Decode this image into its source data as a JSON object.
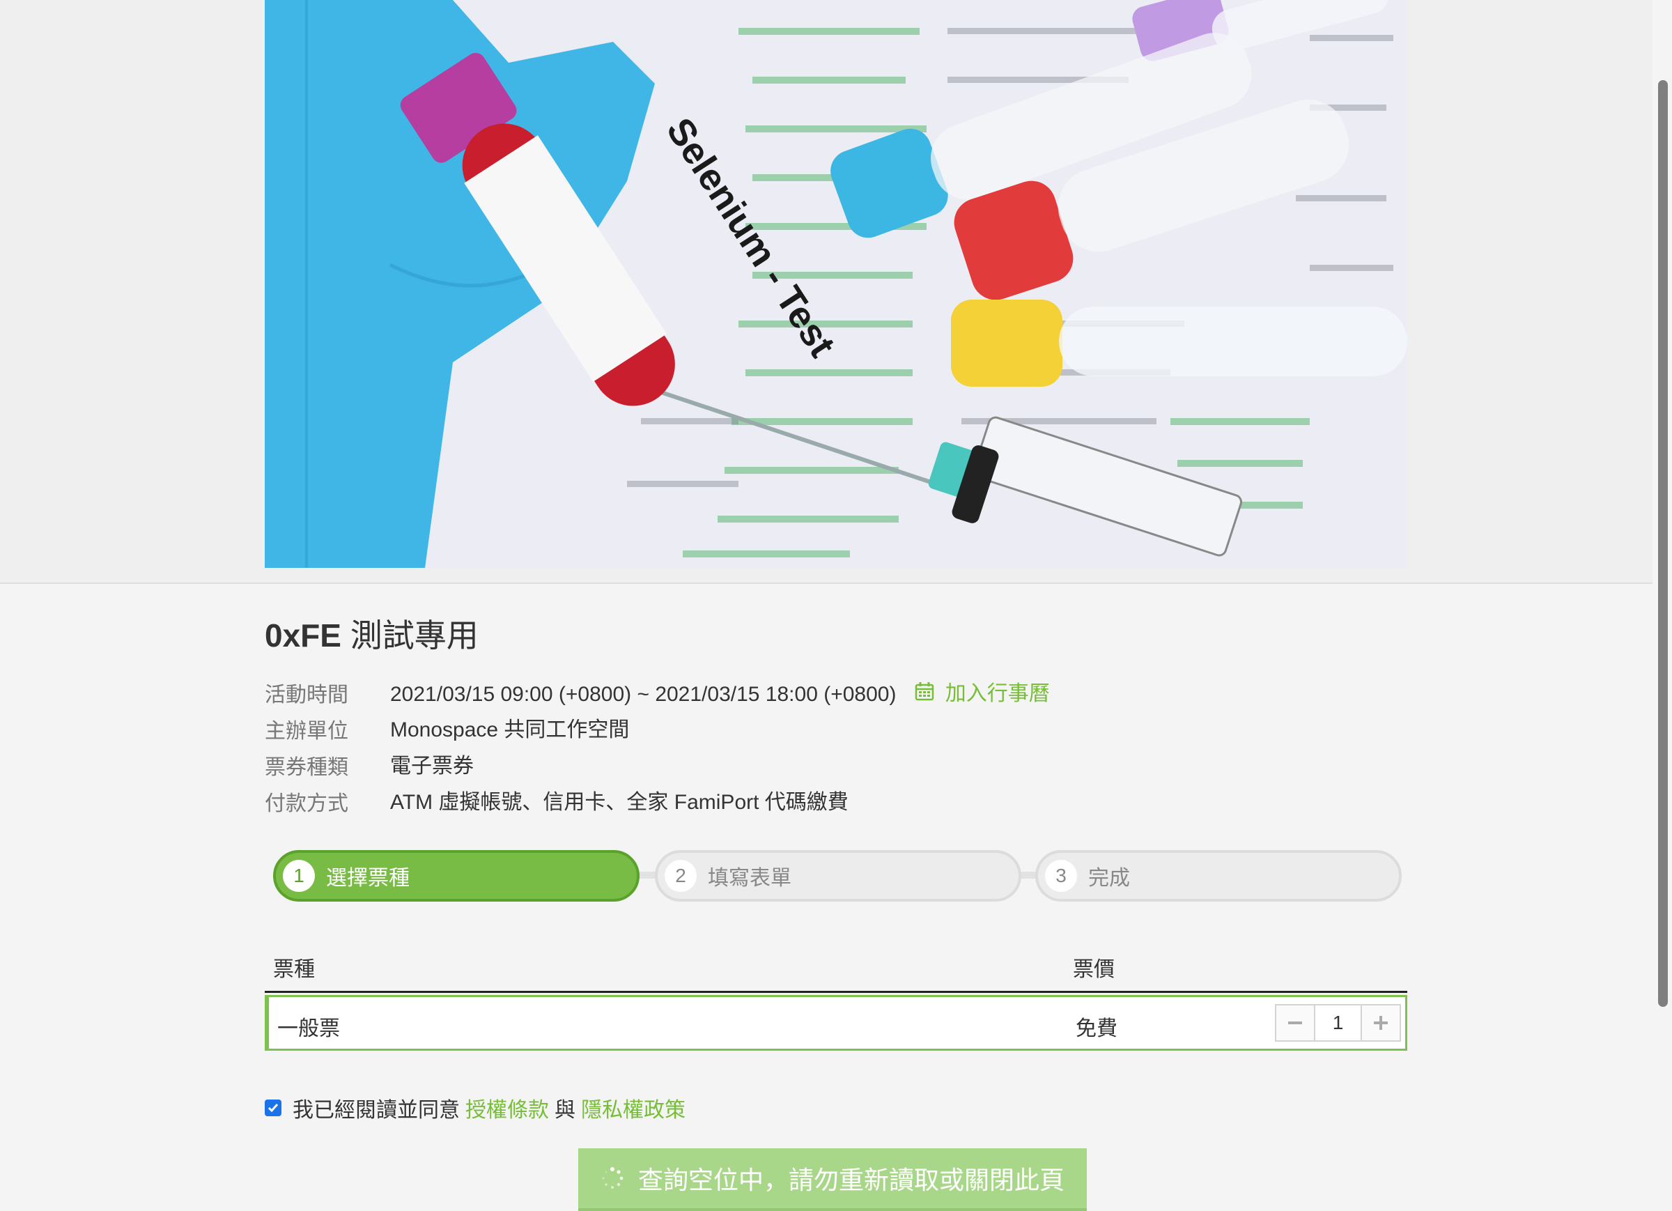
{
  "banner": {
    "tube_label": "Selenium - Test"
  },
  "event": {
    "title_prefix": "0xFE",
    "title_rest": "測試專用",
    "info": [
      {
        "label": "活動時間",
        "value": "2021/03/15 09:00 (+0800) ~ 2021/03/15 18:00 (+0800)"
      },
      {
        "label": "主辦單位",
        "value": "Monospace 共同工作空間"
      },
      {
        "label": "票券種類",
        "value": "電子票券"
      },
      {
        "label": "付款方式",
        "value": "ATM 虛擬帳號、信用卡、全家 FamiPort 代碼繳費"
      }
    ],
    "add_calendar": "加入行事曆"
  },
  "steps": [
    {
      "num": "1",
      "label": "選擇票種",
      "state": "active"
    },
    {
      "num": "2",
      "label": "填寫表單",
      "state": "inactive"
    },
    {
      "num": "3",
      "label": "完成",
      "state": "inactive"
    }
  ],
  "table": {
    "headers": {
      "type": "票種",
      "price": "票價"
    },
    "rows": [
      {
        "name": "一般票",
        "price": "免費",
        "quantity": "1"
      }
    ]
  },
  "agreement": {
    "checked": true,
    "text_before": "我已經閱讀並同意",
    "terms_link": "授權條款",
    "conjunction": "與",
    "privacy_link": "隱私權政策"
  },
  "submit": {
    "label": "查詢空位中，請勿重新讀取或關閉此頁"
  },
  "colors": {
    "accent": "#77bd38",
    "step_active": "#79bc45",
    "submit_disabled": "#a9d78a",
    "checkbox": "#1a73e8"
  }
}
